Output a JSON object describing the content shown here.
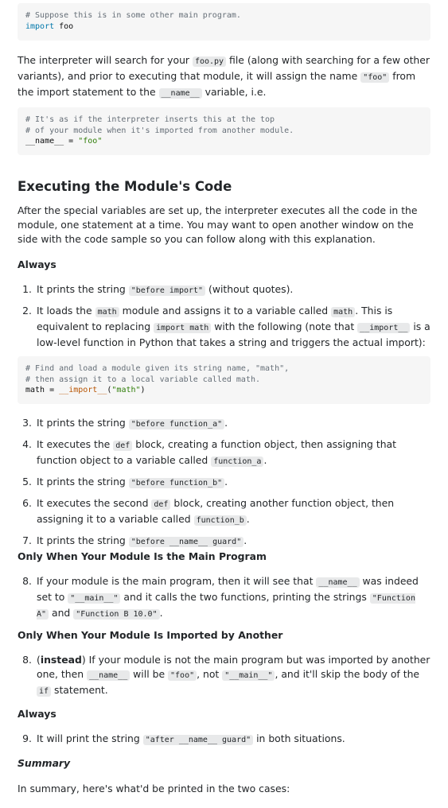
{
  "code1": {
    "line1": "# Suppose this is in some other main program.",
    "line2_kw": "import",
    "line2_rest": " foo"
  },
  "para1": {
    "t1": "The interpreter will search for your ",
    "c1": "foo.py",
    "t2": " file (along with searching for a few other variants), and prior to executing that module, it will assign the name ",
    "c2": "\"foo\"",
    "t3": " from the import statement to the ",
    "c3": "__name__",
    "t4": " variable, i.e."
  },
  "code2": {
    "line1": "# It's as if the interpreter inserts this at the top",
    "line2": "# of your module when it's imported from another module.",
    "line3_a": "__name__ = ",
    "line3_b": "\"foo\""
  },
  "heading": "Executing the Module's Code",
  "para2": "After the special variables are set up, the interpreter executes all the code in the module, one statement at a time. You may want to open another window on the side with the code sample so you can follow along with this explanation.",
  "label_always1": "Always",
  "items_a": {
    "i1_n": "1.",
    "i1_t1": "It prints the string ",
    "i1_c1": "\"before import\"",
    "i1_t2": " (without quotes).",
    "i2_n": "2.",
    "i2_t1": "It loads the ",
    "i2_c1": "math",
    "i2_t2": " module and assigns it to a variable called ",
    "i2_c2": "math",
    "i2_t3": ". This is equivalent to replacing ",
    "i2_c3": "import math",
    "i2_t4": " with the following (note that ",
    "i2_c4": "__import__",
    "i2_t5": " is a low-level function in Python that takes a string and triggers the actual import):"
  },
  "code3": {
    "line1": "# Find and load a module given its string name, \"math\",",
    "line2": "# then assign it to a local variable called math.",
    "line3_a": "math = ",
    "line3_b": "__import__",
    "line3_c": "(",
    "line3_d": "\"math\"",
    "line3_e": ")"
  },
  "items_b": {
    "i3_n": "3.",
    "i3_t1": "It prints the string ",
    "i3_c1": "\"before function_a\"",
    "i3_t2": ".",
    "i4_n": "4.",
    "i4_t1": "It executes the ",
    "i4_c1": "def",
    "i4_t2": " block, creating a function object, then assigning that function object to a variable called ",
    "i4_c2": "function_a",
    "i4_t3": ".",
    "i5_n": "5.",
    "i5_t1": "It prints the string ",
    "i5_c1": "\"before function_b\"",
    "i5_t2": ".",
    "i6_n": "6.",
    "i6_t1": "It executes the second ",
    "i6_c1": "def",
    "i6_t2": " block, creating another function object, then assigning it to a variable called ",
    "i6_c2": "function_b",
    "i6_t3": ".",
    "i7_n": "7.",
    "i7_t1": "It prints the string ",
    "i7_c1": "\"before __name__ guard\"",
    "i7_t2": "."
  },
  "label_main": "Only When Your Module Is the Main Program",
  "item8a": {
    "n": "8.",
    "t1": "If your module is the main program, then it will see that ",
    "c1": "__name__",
    "t2": " was indeed set to ",
    "c2": "\"__main__\"",
    "t3": " and it calls the two functions, printing the strings ",
    "c3": "\"Function A\"",
    "t4": " and ",
    "c4": "\"Function B 10.0\"",
    "t5": "."
  },
  "label_imported": "Only When Your Module Is Imported by Another",
  "item8b": {
    "n": "8.",
    "t0": "(",
    "b": "instead",
    "t1": ") If your module is not the main program but was imported by another one, then ",
    "c1": "__name__",
    "t2": " will be ",
    "c2": "\"foo\"",
    "t3": ", not ",
    "c3": "\"__main__\"",
    "t4": ", and it'll skip the body of the ",
    "c4": "if",
    "t5": " statement."
  },
  "label_always2": "Always",
  "item9": {
    "n": "9.",
    "t1": "It will print the string ",
    "c1": "\"after __name__ guard\"",
    "t2": " in both situations."
  },
  "label_summary": "Summary",
  "para3": "In summary, here's what'd be printed in the two cases:"
}
